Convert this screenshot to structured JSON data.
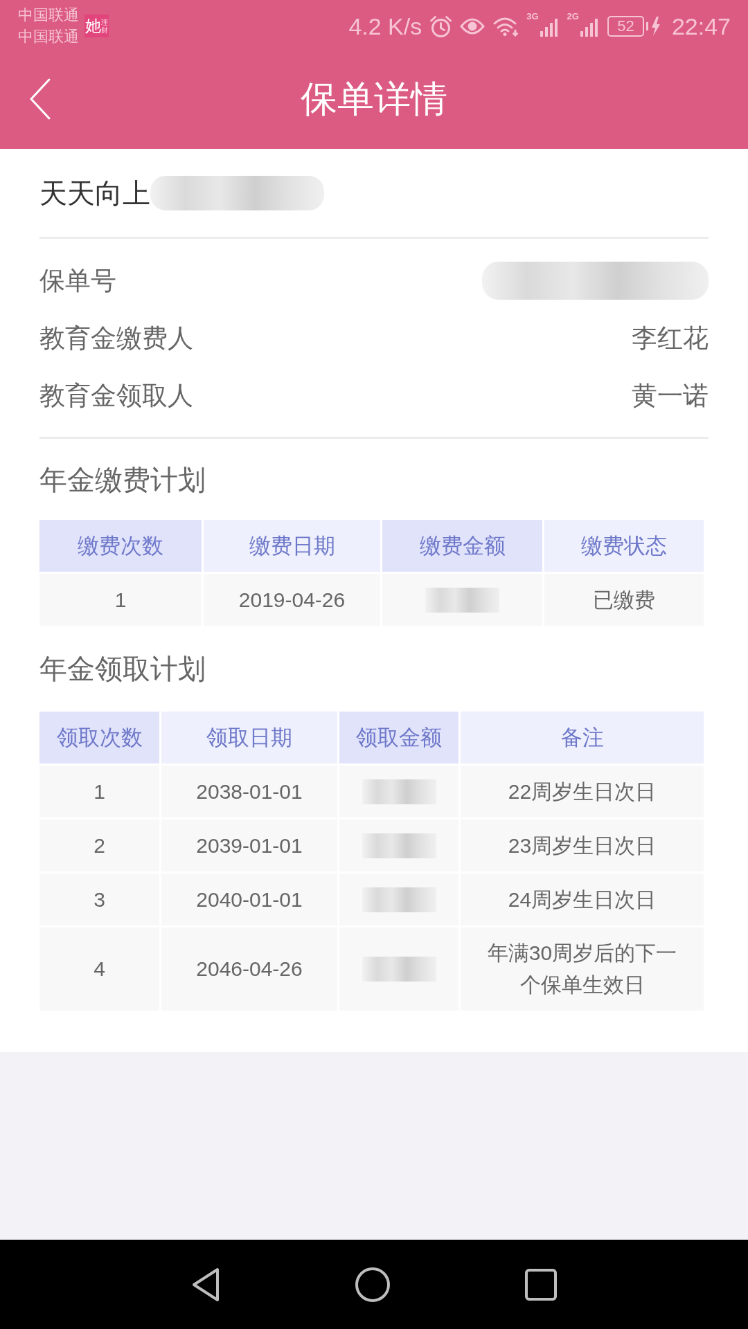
{
  "status_bar": {
    "carriers": [
      "中国联通",
      "中国联通"
    ],
    "app_badge": {
      "mark": "她",
      "caption": "理财"
    },
    "network_speed": "4.2 K/s",
    "signals": [
      {
        "label": "3G"
      },
      {
        "label": "2G"
      }
    ],
    "battery": "52",
    "time": "22:47"
  },
  "header": {
    "title": "保单详情"
  },
  "policy": {
    "name": "天天向上",
    "name_redacted": true,
    "fields": [
      {
        "label": "保单号",
        "redacted": true
      },
      {
        "label": "教育金缴费人",
        "value": "李红花"
      },
      {
        "label": "教育金领取人",
        "value": "黄一诺"
      }
    ]
  },
  "plans": [
    {
      "title": "年金缴费计划",
      "columns": [
        "缴费次数",
        "缴费日期",
        "缴费金额",
        "缴费状态"
      ],
      "rows": [
        [
          "1",
          "2019-04-26",
          {
            "redacted": true
          },
          "已缴费"
        ]
      ]
    },
    {
      "title": "年金领取计划",
      "columns": [
        "领取次数",
        "领取日期",
        "领取金额",
        "备注"
      ],
      "rows": [
        [
          "1",
          "2038-01-01",
          {
            "redacted": true
          },
          "22周岁生日次日"
        ],
        [
          "2",
          "2039-01-01",
          {
            "redacted": true
          },
          "23周岁生日次日"
        ],
        [
          "3",
          "2040-01-01",
          {
            "redacted": true
          },
          "24周岁生日次日"
        ],
        [
          "4",
          "2046-04-26",
          {
            "redacted": true
          },
          "年满30周岁后的下一个保单生效日"
        ]
      ]
    }
  ]
}
